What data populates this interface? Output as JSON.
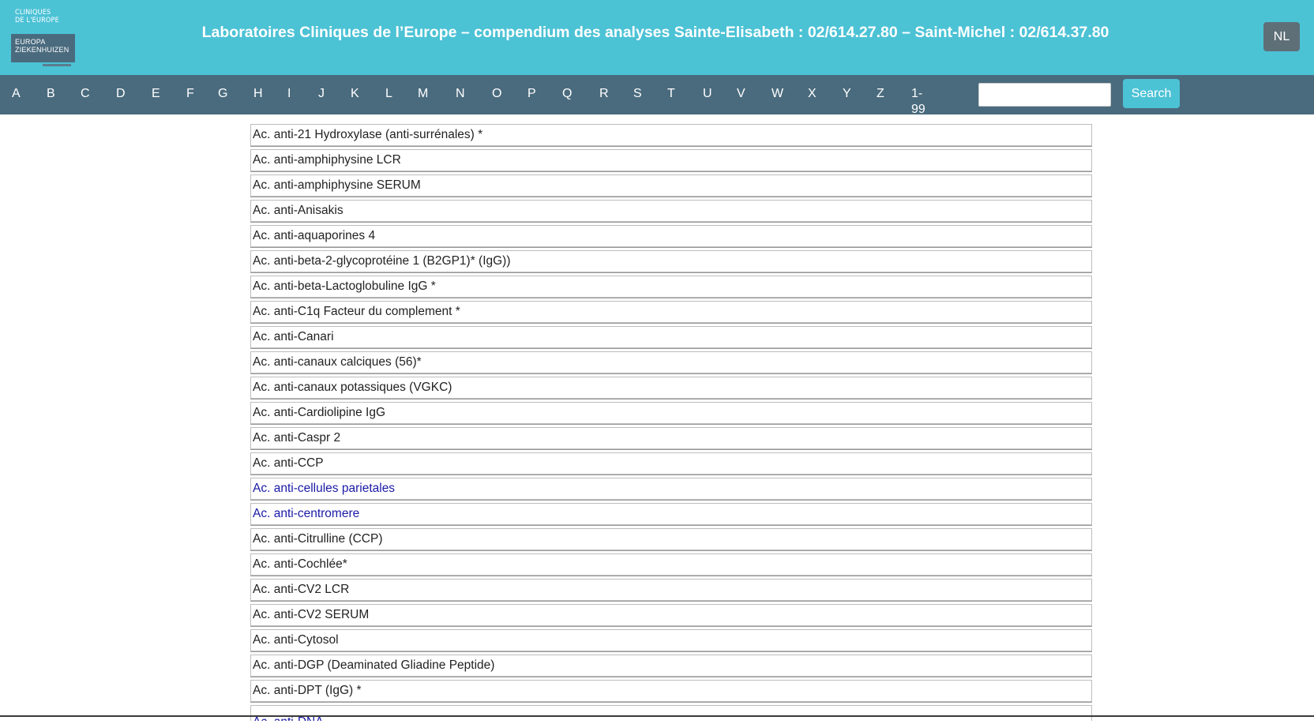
{
  "header": {
    "logo": {
      "top_lines": [
        "CLINIQUES",
        "DE L'EUROPE"
      ],
      "bottom_lines": [
        "EUROPA",
        "ZIEKENHUIZEN"
      ]
    },
    "title": "Laboratoires Cliniques de l’Europe – compendium des analyses Sainte-Elisabeth : 02/614.27.80 – Saint-Michel : 02/614.37.80",
    "lang_button": "NL",
    "colors": {
      "header_bg": "#4cc2d5",
      "nav_bg": "#4a6b7e",
      "lang_bg": "#5f6f78",
      "link_text": "#1a1aa6"
    }
  },
  "nav": {
    "letters": [
      "A",
      "B",
      "C",
      "D",
      "E",
      "F",
      "G",
      "H",
      "I",
      "J",
      "K",
      "L",
      "M",
      "N",
      "O",
      "P",
      "Q",
      "R",
      "S",
      "T",
      "U",
      "V",
      "W",
      "X",
      "Y",
      "Z",
      "1-99"
    ],
    "search": {
      "value": "",
      "placeholder": "",
      "button_label": "Search"
    }
  },
  "list": {
    "items": [
      {
        "label": "Ac. anti-21 Hydroxylase (anti-surrénales) *",
        "link": false
      },
      {
        "label": "Ac. anti-amphiphysine LCR",
        "link": false
      },
      {
        "label": "Ac. anti-amphiphysine SERUM",
        "link": false
      },
      {
        "label": "Ac. anti-Anisakis",
        "link": false
      },
      {
        "label": "Ac. anti-aquaporines 4",
        "link": false
      },
      {
        "label": "Ac. anti-beta-2-glycoprotéine 1 (B2GP1)* (IgG))",
        "link": false
      },
      {
        "label": "Ac. anti-beta-Lactoglobuline IgG *",
        "link": false
      },
      {
        "label": "Ac. anti-C1q Facteur du complement *",
        "link": false
      },
      {
        "label": "Ac. anti-Canari",
        "link": false
      },
      {
        "label": "Ac. anti-canaux calciques (56)*",
        "link": false
      },
      {
        "label": "Ac. anti-canaux potassiques (VGKC)",
        "link": false
      },
      {
        "label": "Ac. anti-Cardiolipine IgG",
        "link": false
      },
      {
        "label": "Ac. anti-Caspr 2",
        "link": false
      },
      {
        "label": "Ac. anti-CCP",
        "link": false
      },
      {
        "label": "Ac. anti-cellules parietales",
        "link": true
      },
      {
        "label": "Ac. anti-centromere",
        "link": true
      },
      {
        "label": "Ac. anti-Citrulline (CCP)",
        "link": false
      },
      {
        "label": "Ac. anti-Cochlée*",
        "link": false
      },
      {
        "label": "Ac. anti-CV2 LCR",
        "link": false
      },
      {
        "label": "Ac. anti-CV2 SERUM",
        "link": false
      },
      {
        "label": "Ac. anti-Cytosol",
        "link": false
      },
      {
        "label": "Ac. anti-DGP (Deaminated Gliadine Peptide)",
        "link": false
      },
      {
        "label": "Ac. anti-DPT (IgG) *",
        "link": false
      },
      {
        "label": "Ac. anti-DNA",
        "link": true
      }
    ]
  }
}
